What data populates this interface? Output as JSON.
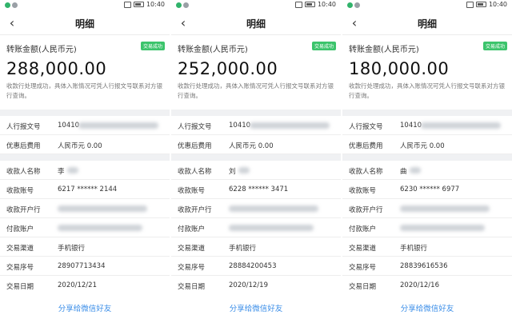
{
  "statusbar": {
    "time": "10:40"
  },
  "screens": [
    {
      "nav_title": "明细",
      "amount_label": "转账金额(人民币元)",
      "badge": "交易成功",
      "amount": "288,000.00",
      "note": "收款行处理成功，具体入账情况可凭人行报文号联系对方银行查询。",
      "rows": {
        "msg_no": {
          "label": "人行报文号",
          "value": "10410"
        },
        "fee": {
          "label": "优惠后费用",
          "value": "人民币元 0.00"
        },
        "payee_name": {
          "label": "收款人名称",
          "value": "李"
        },
        "payee_account": {
          "label": "收款账号",
          "value": "6217 ****** 2144"
        },
        "payee_bank": {
          "label": "收款开户行",
          "value": ""
        },
        "payer_account": {
          "label": "付款账户",
          "value": ""
        },
        "channel": {
          "label": "交易渠道",
          "value": "手机银行"
        },
        "serial": {
          "label": "交易序号",
          "value": "28907713434"
        },
        "date": {
          "label": "交易日期",
          "value": "2020/12/21"
        }
      },
      "share": "分享给微信好友"
    },
    {
      "nav_title": "明细",
      "amount_label": "转账金额(人民币元)",
      "badge": "交易成功",
      "amount": "252,000.00",
      "note": "收款行处理成功，具体入账情况可凭人行报文号联系对方银行查询。",
      "rows": {
        "msg_no": {
          "label": "人行报文号",
          "value": "10410"
        },
        "fee": {
          "label": "优惠后费用",
          "value": "人民币元 0.00"
        },
        "payee_name": {
          "label": "收款人名称",
          "value": "刘"
        },
        "payee_account": {
          "label": "收款账号",
          "value": "6228 ****** 3471"
        },
        "payee_bank": {
          "label": "收款开户行",
          "value": ""
        },
        "payer_account": {
          "label": "付款账户",
          "value": ""
        },
        "channel": {
          "label": "交易渠道",
          "value": "手机银行"
        },
        "serial": {
          "label": "交易序号",
          "value": "28884200453"
        },
        "date": {
          "label": "交易日期",
          "value": "2020/12/19"
        }
      },
      "share": "分享给微信好友"
    },
    {
      "nav_title": "明细",
      "amount_label": "转账金额(人民币元)",
      "badge": "交易成功",
      "amount": "180,000.00",
      "note": "收款行处理成功，具体入账情况可凭人行报文号联系对方银行查询。",
      "rows": {
        "msg_no": {
          "label": "人行报文号",
          "value": "10410"
        },
        "fee": {
          "label": "优惠后费用",
          "value": "人民币元 0.00"
        },
        "payee_name": {
          "label": "收款人名称",
          "value": "曲"
        },
        "payee_account": {
          "label": "收款账号",
          "value": "6230 ****** 6977"
        },
        "payee_bank": {
          "label": "收款开户行",
          "value": ""
        },
        "payer_account": {
          "label": "付款账户",
          "value": ""
        },
        "channel": {
          "label": "交易渠道",
          "value": "手机银行"
        },
        "serial": {
          "label": "交易序号",
          "value": "28839616536"
        },
        "date": {
          "label": "交易日期",
          "value": "2020/12/16"
        }
      },
      "share": "分享给微信好友"
    }
  ]
}
